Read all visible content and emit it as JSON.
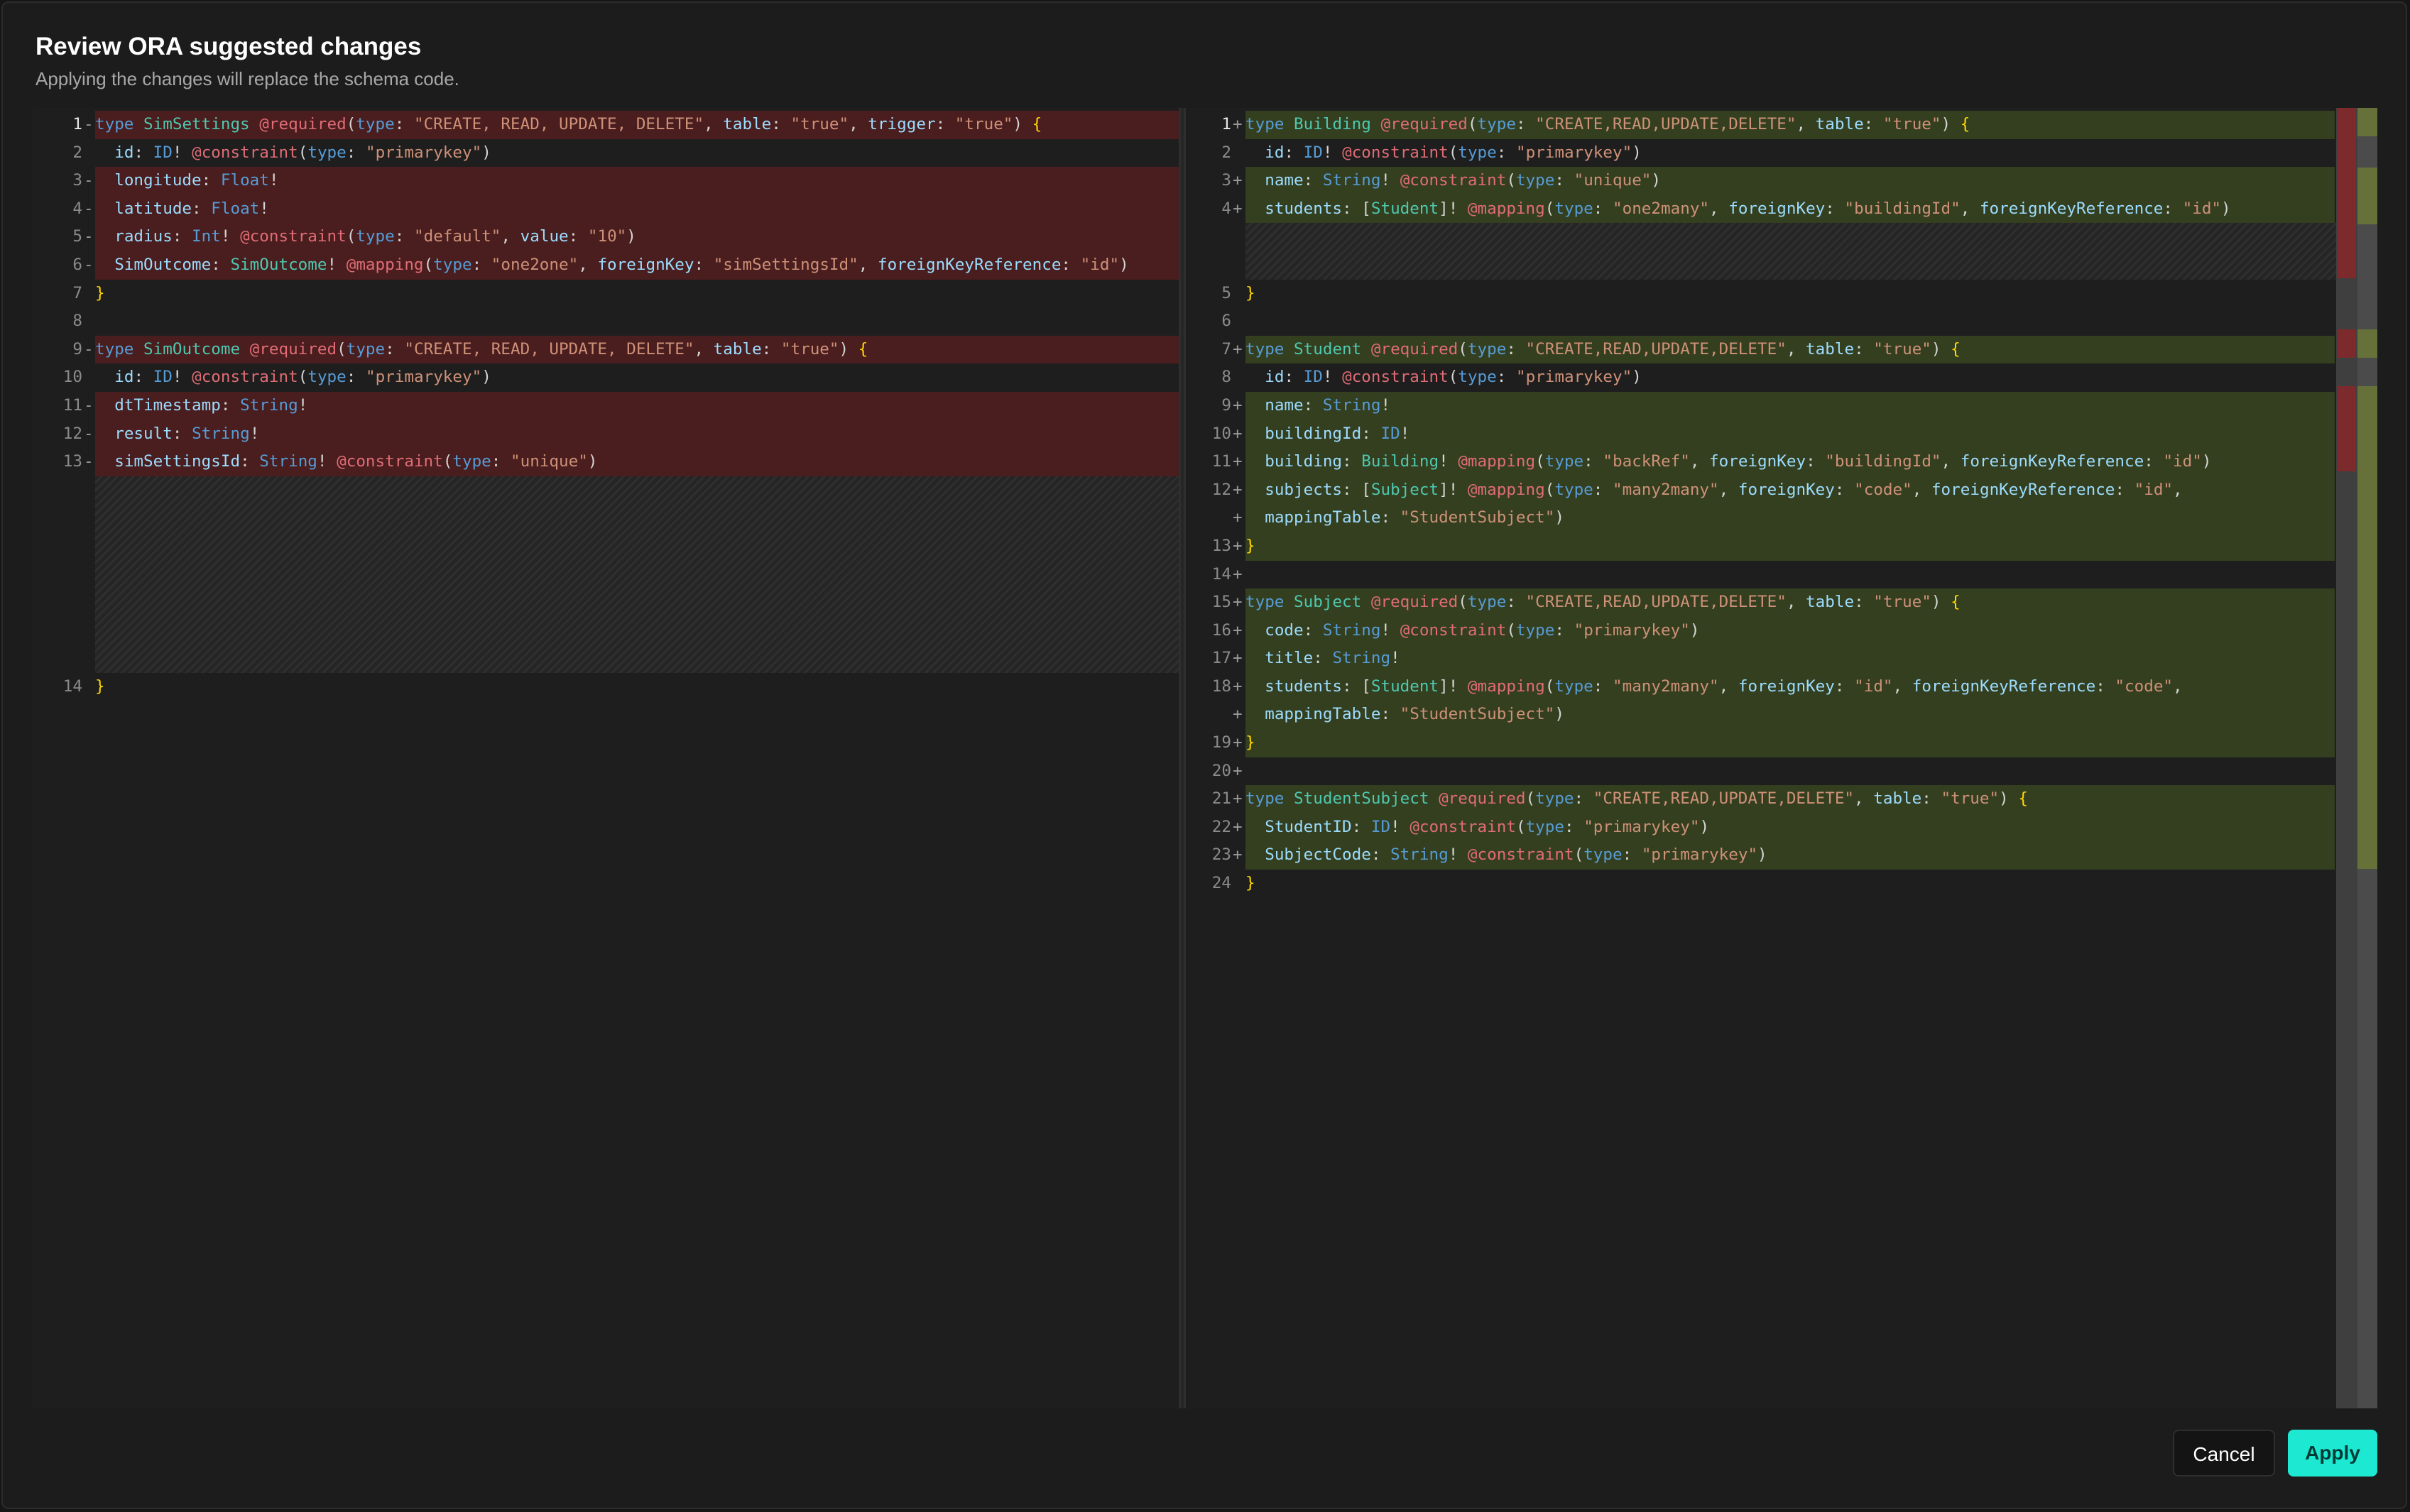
{
  "dialog": {
    "title": "Review ORA suggested changes",
    "subtitle": "Applying the changes will replace the schema code.",
    "cancel_label": "Cancel",
    "apply_label": "Apply"
  },
  "colors": {
    "deleted_line": "#4a1d1e",
    "added_line": "#343f1f",
    "apply_button": "#1de9d2",
    "keyword": "#569cd6",
    "type": "#4ec9b0",
    "annotation": "#e06c75",
    "string": "#ce9178",
    "property": "#9cdcfe"
  },
  "left_pane": {
    "line_numbers": [
      "1",
      "2",
      "3",
      "4",
      "5",
      "6",
      "7",
      "8",
      "9",
      "10",
      "11",
      "12",
      "13",
      "14"
    ],
    "markers": [
      "-",
      "",
      "-",
      "-",
      "-",
      "-",
      "",
      "",
      "-",
      "",
      "-",
      "-",
      "-",
      ""
    ],
    "lines": [
      "type SimSettings @required(type: \"CREATE, READ, UPDATE, DELETE\", table: \"true\", trigger: \"true\") {",
      "  id: ID! @constraint(type: \"primarykey\")",
      "  longitude: Float!",
      "  latitude: Float!",
      "  radius: Int! @constraint(type: \"default\", value: \"10\")",
      "  SimOutcome: SimOutcome! @mapping(type: \"one2one\", foreignKey: \"simSettingsId\", foreignKeyReference: \"id\")",
      "}",
      "",
      "type SimOutcome @required(type: \"CREATE, READ, UPDATE, DELETE\", table: \"true\") {",
      "  id: ID! @constraint(type: \"primarykey\")",
      "  dtTimestamp: String!",
      "  result: String!",
      "  simSettingsId: String! @constraint(type: \"unique\")",
      "}"
    ]
  },
  "right_pane": {
    "line_numbers": [
      "1",
      "2",
      "3",
      "4",
      "5",
      "6",
      "7",
      "8",
      "9",
      "10",
      "11",
      "12",
      "",
      "13",
      "14",
      "15",
      "16",
      "17",
      "18",
      "",
      "19",
      "20",
      "21",
      "22",
      "23",
      "24"
    ],
    "markers": [
      "+",
      "",
      "+",
      "+",
      "",
      "",
      "+",
      "",
      "+",
      "+",
      "+",
      "+",
      "+",
      "+",
      "+",
      "+",
      "+",
      "+",
      "+",
      "+",
      "+",
      "+",
      "+",
      "+",
      "+",
      ""
    ],
    "lines": [
      "type Building @required(type: \"CREATE,READ,UPDATE,DELETE\", table: \"true\") {",
      "  id: ID! @constraint(type: \"primarykey\")",
      "  name: String! @constraint(type: \"unique\")",
      "  students: [Student]! @mapping(type: \"one2many\", foreignKey: \"buildingId\", foreignKeyReference: \"id\")",
      "}",
      "",
      "type Student @required(type: \"CREATE,READ,UPDATE,DELETE\", table: \"true\") {",
      "  id: ID! @constraint(type: \"primarykey\")",
      "  name: String!",
      "  buildingId: ID!",
      "  building: Building! @mapping(type: \"backRef\", foreignKey: \"buildingId\", foreignKeyReference: \"id\")",
      "  subjects: [Subject]! @mapping(type: \"many2many\", foreignKey: \"code\", foreignKeyReference: \"id\",",
      "  mappingTable: \"StudentSubject\")",
      "}",
      "",
      "type Subject @required(type: \"CREATE,READ,UPDATE,DELETE\", table: \"true\") {",
      "  code: String! @constraint(type: \"primarykey\")",
      "  title: String!",
      "  students: [Student]! @mapping(type: \"many2many\", foreignKey: \"id\", foreignKeyReference: \"code\",",
      "  mappingTable: \"StudentSubject\")",
      "}",
      "",
      "type StudentSubject @required(type: \"CREATE,READ,UPDATE,DELETE\", table: \"true\") {",
      "  StudentID: ID! @constraint(type: \"primarykey\")",
      "  SubjectCode: String! @constraint(type: \"primarykey\")",
      "}"
    ]
  }
}
